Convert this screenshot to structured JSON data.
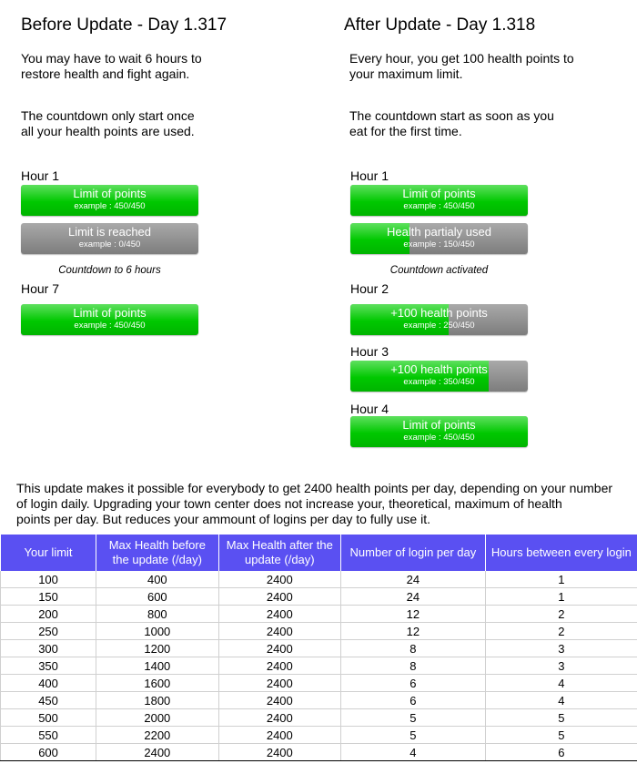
{
  "before": {
    "title": "Before Update - Day 1.317",
    "p1": [
      "You may have to wait 6 hours to",
      "restore health and fight again."
    ],
    "p2": [
      "The countdown only start once",
      "all your health points are used."
    ],
    "hours": [
      "Hour 1",
      "Hour 7"
    ],
    "countdown": "Countdown to 6 hours",
    "bars": [
      {
        "label": "Limit of points",
        "example": "example : 450/450",
        "value": 450,
        "max": 450
      },
      {
        "label": "Limit is reached",
        "example": "example : 0/450",
        "value": 0,
        "max": 450
      },
      {
        "label": "Limit of points",
        "example": "example : 450/450",
        "value": 450,
        "max": 450
      }
    ]
  },
  "after": {
    "title": "After Update - Day 1.318",
    "p1": [
      "Every hour, you get 100 health points to",
      "your maximum limit."
    ],
    "p2": [
      "The countdown start as soon as you",
      "eat for the first time."
    ],
    "hours": [
      "Hour 1",
      "Hour 2",
      "Hour 3",
      "Hour 4"
    ],
    "countdown": "Countdown activated",
    "bars": [
      {
        "label": "Limit of points",
        "example": "example : 450/450",
        "value": 450,
        "max": 450
      },
      {
        "label": "Health partialy used",
        "example": "example : 150/450",
        "value": 150,
        "max": 450
      },
      {
        "label": "+100 health points",
        "example": "example : 250/450",
        "value": 250,
        "max": 450
      },
      {
        "label": "+100 health points",
        "example": "example : 350/450",
        "value": 350,
        "max": 450
      },
      {
        "label": "Limit of points",
        "example": "example : 450/450",
        "value": 450,
        "max": 450
      }
    ]
  },
  "summary": [
    "This update makes it possible for everybody to get 2400 health points per day, depending on your number",
    "of login daily. Upgrading your town center does not increase your, theoretical, maximum of health",
    "points per day. But reduces your ammount of logins per day to fully use it."
  ],
  "colors": {
    "green": "#00c800",
    "gray": "#8c8c8c",
    "header": "#5a50f2"
  },
  "table": {
    "headers": [
      "Your limit",
      "Max Health before the update (/day)",
      "Max Health after the update (/day)",
      "Number of login per day",
      "Hours between every login"
    ],
    "rows": [
      [
        "100",
        "400",
        "2400",
        "24",
        "1"
      ],
      [
        "150",
        "600",
        "2400",
        "24",
        "1"
      ],
      [
        "200",
        "800",
        "2400",
        "12",
        "2"
      ],
      [
        "250",
        "1000",
        "2400",
        "12",
        "2"
      ],
      [
        "300",
        "1200",
        "2400",
        "8",
        "3"
      ],
      [
        "350",
        "1400",
        "2400",
        "8",
        "3"
      ],
      [
        "400",
        "1600",
        "2400",
        "6",
        "4"
      ],
      [
        "450",
        "1800",
        "2400",
        "6",
        "4"
      ],
      [
        "500",
        "2000",
        "2400",
        "5",
        "5"
      ],
      [
        "550",
        "2200",
        "2400",
        "5",
        "5"
      ],
      [
        "600",
        "2400",
        "2400",
        "4",
        "6"
      ]
    ]
  }
}
